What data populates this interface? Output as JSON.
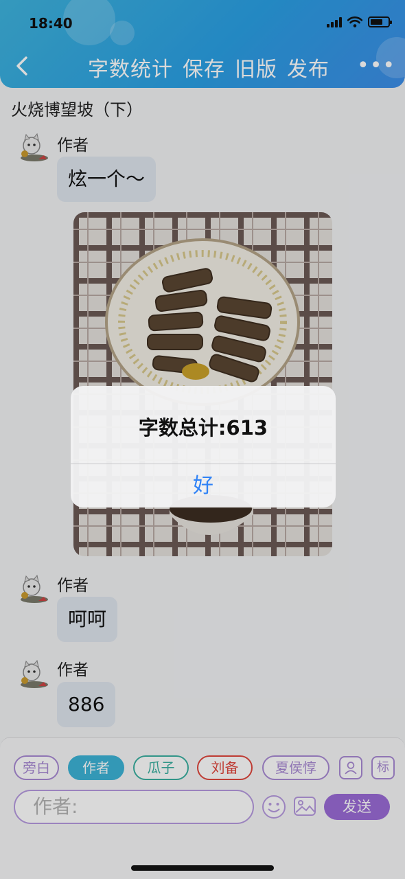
{
  "status_bar": {
    "time": "18:40"
  },
  "nav": {
    "items": [
      "字数统计",
      "保存",
      "旧版",
      "发布"
    ],
    "more": "•••"
  },
  "story": {
    "title": "火烧博望坡（下）"
  },
  "messages": [
    {
      "author": "作者",
      "text": "炫一个～"
    },
    {
      "author": "作者",
      "type": "image"
    },
    {
      "author": "作者",
      "text": "呵呵"
    },
    {
      "author": "作者",
      "text": "886"
    }
  ],
  "dialog": {
    "title": "字数总计:613",
    "button": "好"
  },
  "composer": {
    "roles": [
      "旁白",
      "作者",
      "瓜子",
      "刘备",
      "夏侯惇"
    ],
    "role_colors": [
      "#a98ad4",
      "#3cb3d6",
      "#3ab0a0",
      "#e0463c",
      "#a98ad4"
    ],
    "active_role": "作者",
    "label_button": "标",
    "input_placeholder": "作者:",
    "send_label": "发送"
  },
  "colors": {
    "header": "#2aa0e4",
    "accent": "#9b6bd6",
    "dialog_button": "#2f82f6"
  }
}
